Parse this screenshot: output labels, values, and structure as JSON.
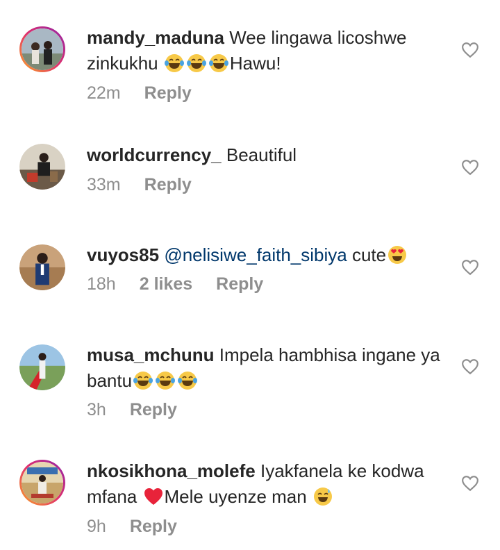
{
  "comments": [
    {
      "username": "mandy_maduna",
      "text_before": "Wee lingawa licoshwe zinkukhu",
      "emojis": [
        "laugh-cry",
        "laugh-cry",
        "laugh-cry"
      ],
      "text_after": "Hawu!",
      "time": "22m",
      "reply": "Reply"
    },
    {
      "username": "worldcurrency_",
      "text_before": "Beautiful",
      "time": "33m",
      "reply": "Reply"
    },
    {
      "username": "vuyos85",
      "mention": "@nelisiwe_faith_sibiya",
      "text_before": "cute",
      "emojis": [
        "heart-eyes"
      ],
      "time": "18h",
      "likes": "2 likes",
      "reply": "Reply"
    },
    {
      "username": "musa_mchunu",
      "text_before": "Impela hambhisa ingane ya bantu",
      "emojis": [
        "laugh-cry",
        "laugh-cry",
        "laugh-cry"
      ],
      "time": "3h",
      "reply": "Reply"
    },
    {
      "username": "nkosikhona_molefe",
      "text_before": "Iyakfanela ke kodwa mfana",
      "emojis": [
        "red-heart"
      ],
      "text_after": "Mele uyenze man",
      "emoji_end": "sweat-smile",
      "time": "9h",
      "reply": "Reply"
    }
  ]
}
